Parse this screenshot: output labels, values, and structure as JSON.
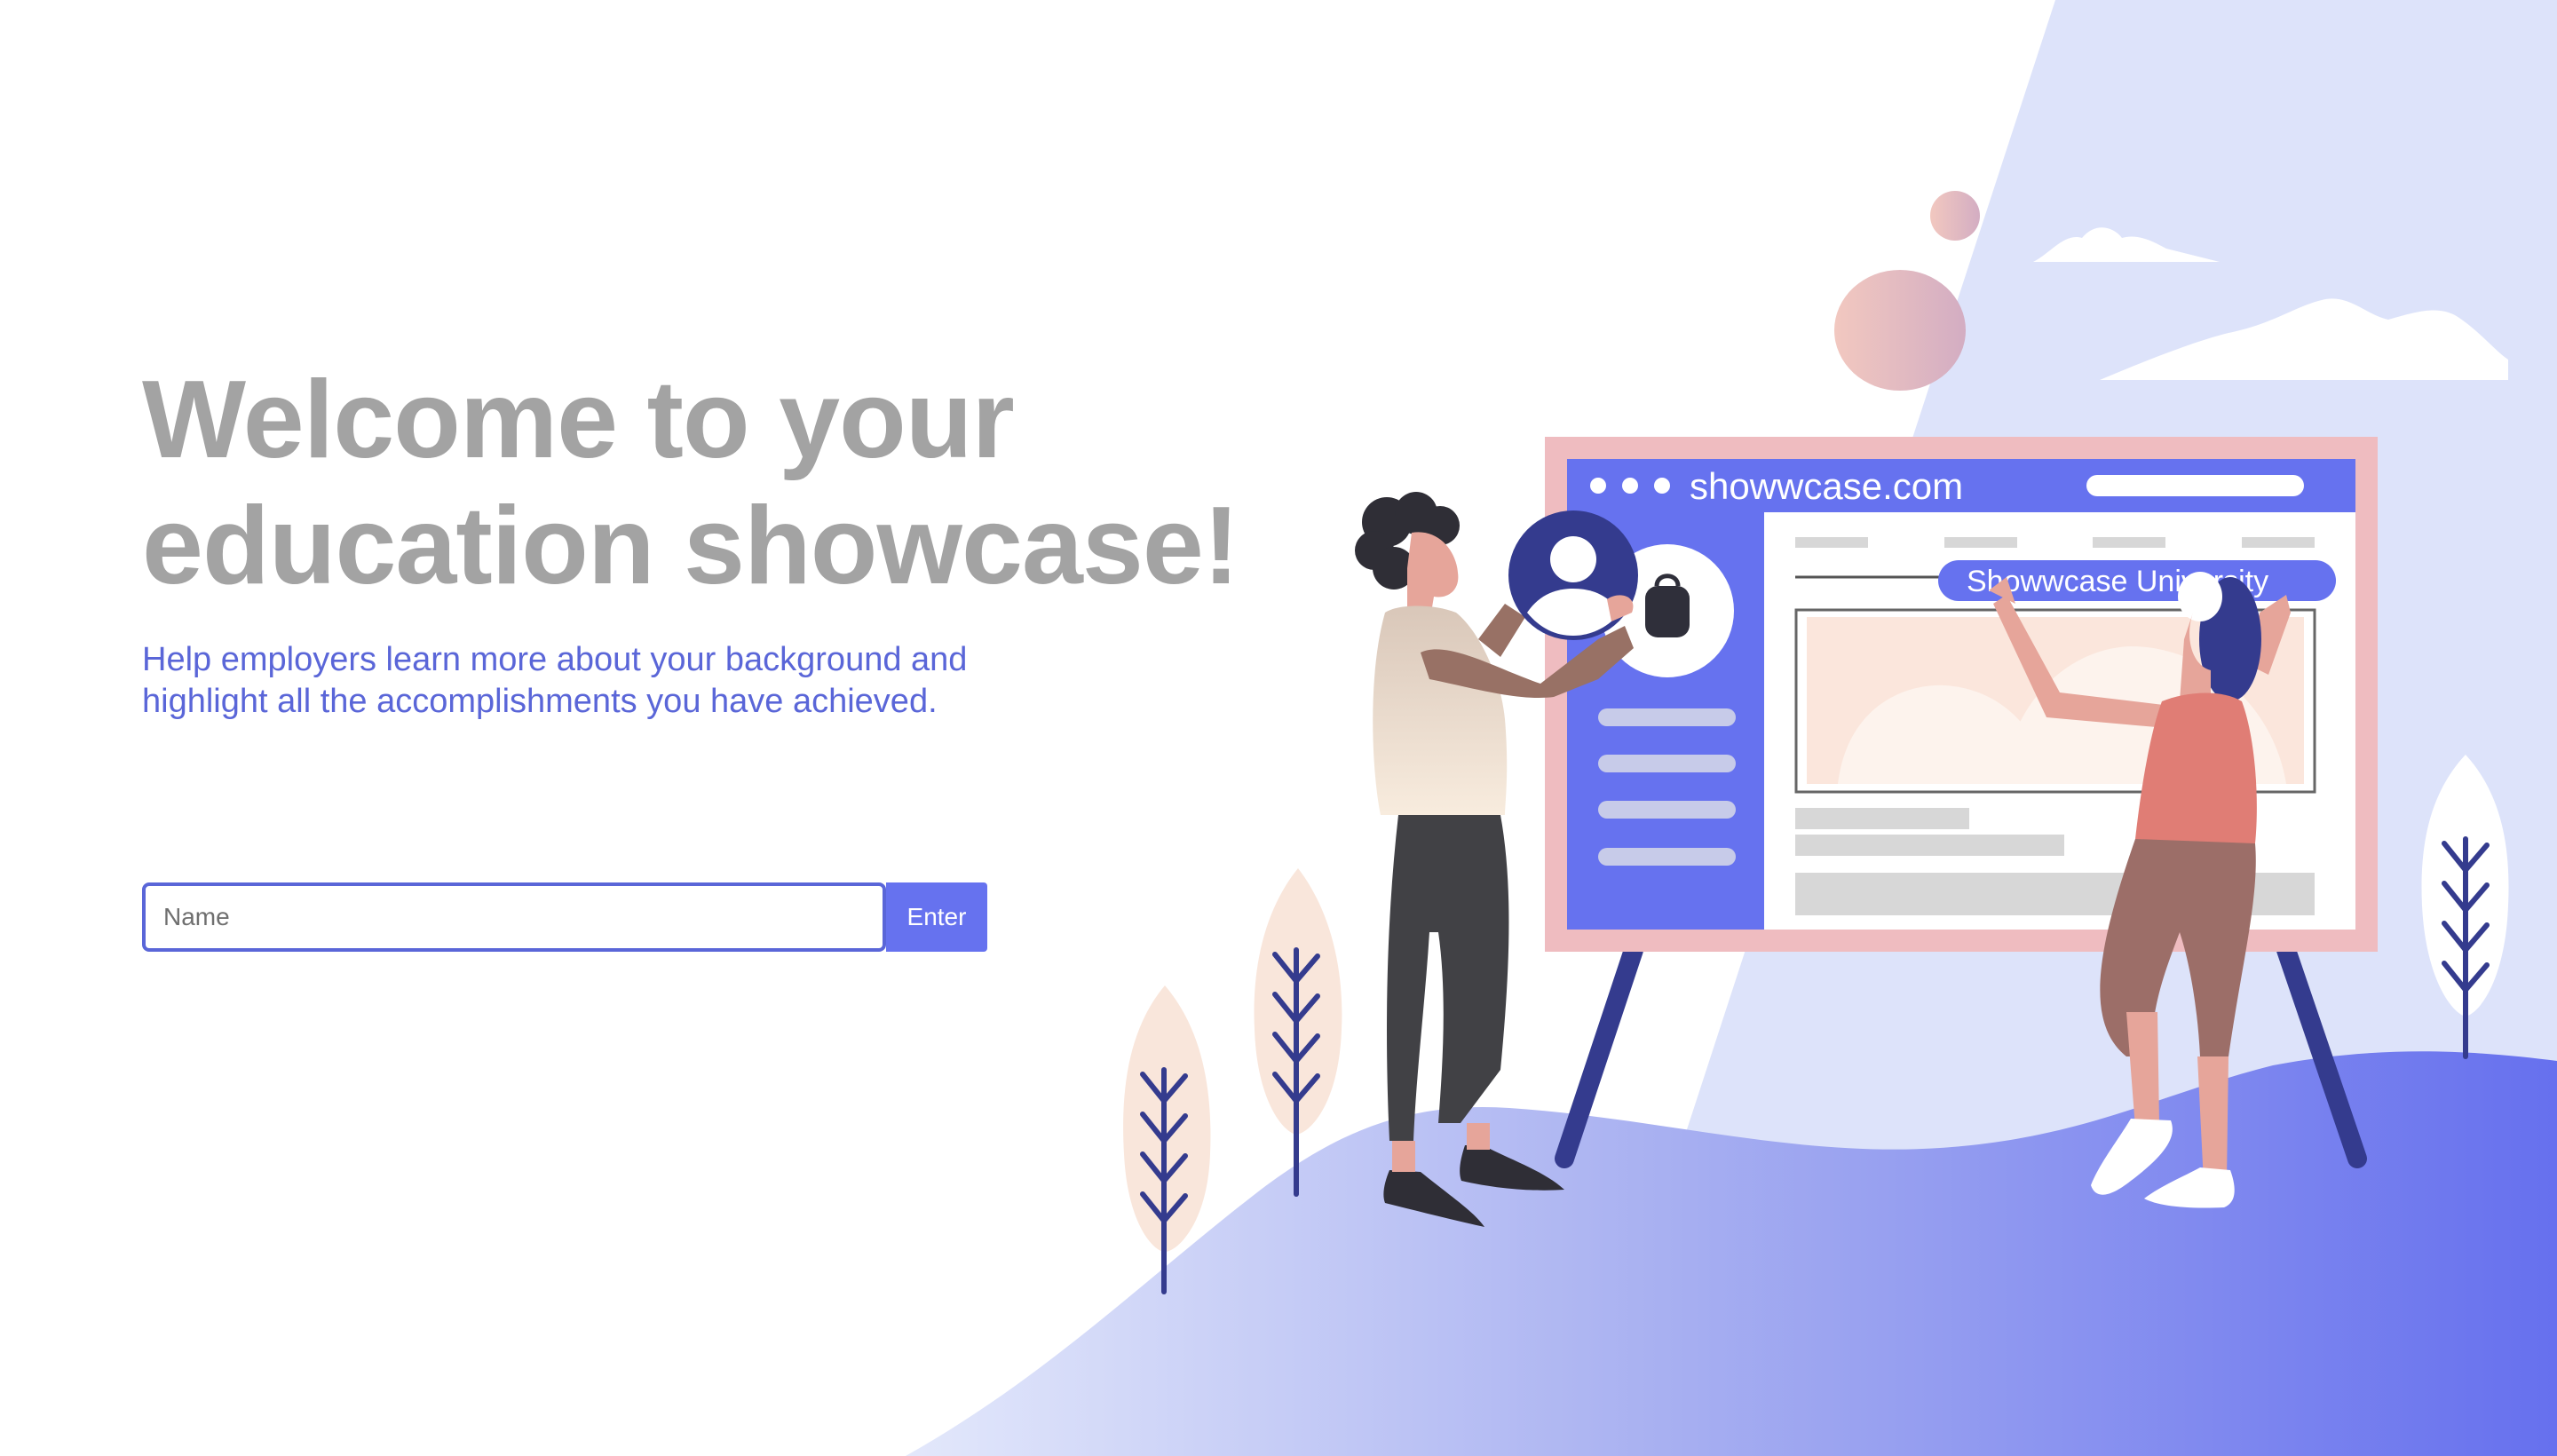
{
  "hero": {
    "title_line1": "Welcome to your",
    "title_line2": "education showcase!",
    "subtitle_line1": "Help employers learn more about your background and",
    "subtitle_line2": "highlight all the accomplishments you have achieved."
  },
  "form": {
    "name_placeholder": "Name",
    "name_value": "",
    "enter_label": "Enter"
  },
  "illustration": {
    "browser_url": "showwcase.com",
    "banner_text": "Showwcase University",
    "icons": [
      "profile-icon",
      "backpack-icon",
      "window-dot-icon"
    ]
  },
  "colors": {
    "heading": "#a3a3a3",
    "accent": "#5a66d8",
    "button": "#6672ef",
    "sky": "#dde3fa",
    "board_frame": "#efbcc0"
  }
}
